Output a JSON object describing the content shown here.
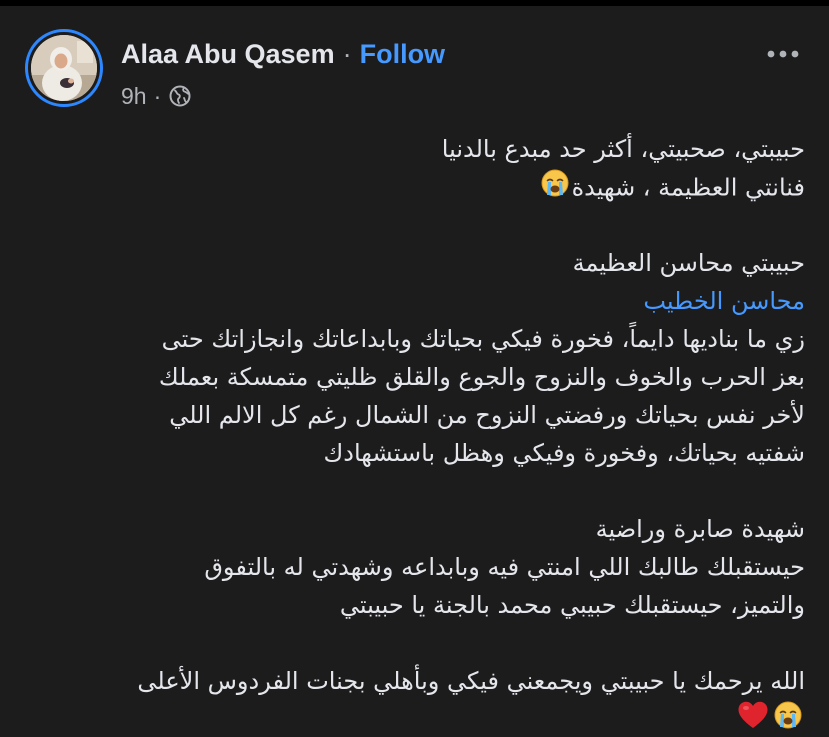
{
  "post": {
    "author_name": "Alaa Abu Qasem",
    "separator": "·",
    "follow_label": "Follow",
    "time": "9h",
    "meta_separator": "·",
    "privacy_icon": "globe-icon",
    "more_icon": "more-options-icon"
  },
  "body": {
    "p1_line1": "حبيبتي، صحبيتي، أكثر حد مبدع بالدنيا",
    "p1_line2": "فنانتي العظيمة ، شهيدة",
    "p2_line1": "حبيبتي محاسن العظيمة",
    "mention": "محاسن الخطيب",
    "p3_line1": "زي ما بناديها دايماً، فخورة فيكي بحياتك وبابداعاتك وانجازاتك حتى",
    "p3_line2": "بعز الحرب والخوف والنزوح والجوع والقلق ظليتي متمسكة بعملك",
    "p3_line3": "لأخر نفس بحياتك ورفضتي النزوح من الشمال رغم كل الالم اللي",
    "p3_line4": "شفتيه بحياتك، وفخورة وفيكي وهظل باستشهادك",
    "p4_line1": "شهيدة صابرة وراضية",
    "p4_line2": "حيستقبلك طالبك اللي امنتي فيه وبابداعه وشهدتي له بالتفوق",
    "p4_line3": "والتميز، حيستقبلك حبيبي محمد بالجنة يا حبيبتي",
    "p5_line1": "الله يرحمك يا حبيبتي ويجمعني فيكي وبأهلي بجنات الفردوس الأعلى"
  },
  "colors": {
    "background": "#1c1c1d",
    "text": "#e4e6eb",
    "secondary_text": "#b0b3b8",
    "link_blue": "#4599ff",
    "avatar_ring": "#2d88ff"
  },
  "emojis": {
    "crying": "loudly-crying-face-emoji",
    "heart": "red-heart-emoji"
  }
}
